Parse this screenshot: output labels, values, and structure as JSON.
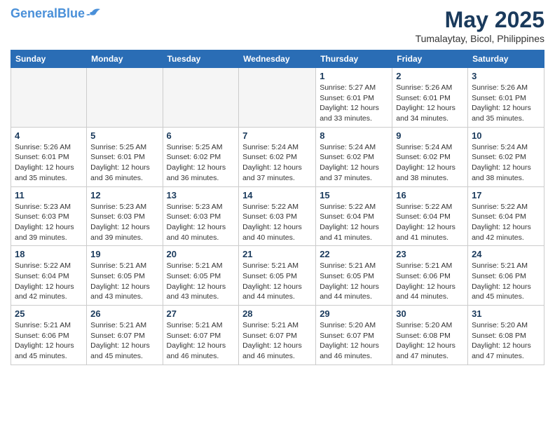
{
  "header": {
    "logo_line1": "General",
    "logo_line2": "Blue",
    "month_year": "May 2025",
    "location": "Tumalaytay, Bicol, Philippines"
  },
  "days_of_week": [
    "Sunday",
    "Monday",
    "Tuesday",
    "Wednesday",
    "Thursday",
    "Friday",
    "Saturday"
  ],
  "weeks": [
    [
      {
        "day": "",
        "info": "",
        "empty": true
      },
      {
        "day": "",
        "info": "",
        "empty": true
      },
      {
        "day": "",
        "info": "",
        "empty": true
      },
      {
        "day": "",
        "info": "",
        "empty": true
      },
      {
        "day": "1",
        "info": "Sunrise: 5:27 AM\nSunset: 6:01 PM\nDaylight: 12 hours\nand 33 minutes.",
        "empty": false
      },
      {
        "day": "2",
        "info": "Sunrise: 5:26 AM\nSunset: 6:01 PM\nDaylight: 12 hours\nand 34 minutes.",
        "empty": false
      },
      {
        "day": "3",
        "info": "Sunrise: 5:26 AM\nSunset: 6:01 PM\nDaylight: 12 hours\nand 35 minutes.",
        "empty": false
      }
    ],
    [
      {
        "day": "4",
        "info": "Sunrise: 5:26 AM\nSunset: 6:01 PM\nDaylight: 12 hours\nand 35 minutes.",
        "empty": false
      },
      {
        "day": "5",
        "info": "Sunrise: 5:25 AM\nSunset: 6:01 PM\nDaylight: 12 hours\nand 36 minutes.",
        "empty": false
      },
      {
        "day": "6",
        "info": "Sunrise: 5:25 AM\nSunset: 6:02 PM\nDaylight: 12 hours\nand 36 minutes.",
        "empty": false
      },
      {
        "day": "7",
        "info": "Sunrise: 5:24 AM\nSunset: 6:02 PM\nDaylight: 12 hours\nand 37 minutes.",
        "empty": false
      },
      {
        "day": "8",
        "info": "Sunrise: 5:24 AM\nSunset: 6:02 PM\nDaylight: 12 hours\nand 37 minutes.",
        "empty": false
      },
      {
        "day": "9",
        "info": "Sunrise: 5:24 AM\nSunset: 6:02 PM\nDaylight: 12 hours\nand 38 minutes.",
        "empty": false
      },
      {
        "day": "10",
        "info": "Sunrise: 5:24 AM\nSunset: 6:02 PM\nDaylight: 12 hours\nand 38 minutes.",
        "empty": false
      }
    ],
    [
      {
        "day": "11",
        "info": "Sunrise: 5:23 AM\nSunset: 6:03 PM\nDaylight: 12 hours\nand 39 minutes.",
        "empty": false
      },
      {
        "day": "12",
        "info": "Sunrise: 5:23 AM\nSunset: 6:03 PM\nDaylight: 12 hours\nand 39 minutes.",
        "empty": false
      },
      {
        "day": "13",
        "info": "Sunrise: 5:23 AM\nSunset: 6:03 PM\nDaylight: 12 hours\nand 40 minutes.",
        "empty": false
      },
      {
        "day": "14",
        "info": "Sunrise: 5:22 AM\nSunset: 6:03 PM\nDaylight: 12 hours\nand 40 minutes.",
        "empty": false
      },
      {
        "day": "15",
        "info": "Sunrise: 5:22 AM\nSunset: 6:04 PM\nDaylight: 12 hours\nand 41 minutes.",
        "empty": false
      },
      {
        "day": "16",
        "info": "Sunrise: 5:22 AM\nSunset: 6:04 PM\nDaylight: 12 hours\nand 41 minutes.",
        "empty": false
      },
      {
        "day": "17",
        "info": "Sunrise: 5:22 AM\nSunset: 6:04 PM\nDaylight: 12 hours\nand 42 minutes.",
        "empty": false
      }
    ],
    [
      {
        "day": "18",
        "info": "Sunrise: 5:22 AM\nSunset: 6:04 PM\nDaylight: 12 hours\nand 42 minutes.",
        "empty": false
      },
      {
        "day": "19",
        "info": "Sunrise: 5:21 AM\nSunset: 6:05 PM\nDaylight: 12 hours\nand 43 minutes.",
        "empty": false
      },
      {
        "day": "20",
        "info": "Sunrise: 5:21 AM\nSunset: 6:05 PM\nDaylight: 12 hours\nand 43 minutes.",
        "empty": false
      },
      {
        "day": "21",
        "info": "Sunrise: 5:21 AM\nSunset: 6:05 PM\nDaylight: 12 hours\nand 44 minutes.",
        "empty": false
      },
      {
        "day": "22",
        "info": "Sunrise: 5:21 AM\nSunset: 6:05 PM\nDaylight: 12 hours\nand 44 minutes.",
        "empty": false
      },
      {
        "day": "23",
        "info": "Sunrise: 5:21 AM\nSunset: 6:06 PM\nDaylight: 12 hours\nand 44 minutes.",
        "empty": false
      },
      {
        "day": "24",
        "info": "Sunrise: 5:21 AM\nSunset: 6:06 PM\nDaylight: 12 hours\nand 45 minutes.",
        "empty": false
      }
    ],
    [
      {
        "day": "25",
        "info": "Sunrise: 5:21 AM\nSunset: 6:06 PM\nDaylight: 12 hours\nand 45 minutes.",
        "empty": false
      },
      {
        "day": "26",
        "info": "Sunrise: 5:21 AM\nSunset: 6:07 PM\nDaylight: 12 hours\nand 45 minutes.",
        "empty": false
      },
      {
        "day": "27",
        "info": "Sunrise: 5:21 AM\nSunset: 6:07 PM\nDaylight: 12 hours\nand 46 minutes.",
        "empty": false
      },
      {
        "day": "28",
        "info": "Sunrise: 5:21 AM\nSunset: 6:07 PM\nDaylight: 12 hours\nand 46 minutes.",
        "empty": false
      },
      {
        "day": "29",
        "info": "Sunrise: 5:20 AM\nSunset: 6:07 PM\nDaylight: 12 hours\nand 46 minutes.",
        "empty": false
      },
      {
        "day": "30",
        "info": "Sunrise: 5:20 AM\nSunset: 6:08 PM\nDaylight: 12 hours\nand 47 minutes.",
        "empty": false
      },
      {
        "day": "31",
        "info": "Sunrise: 5:20 AM\nSunset: 6:08 PM\nDaylight: 12 hours\nand 47 minutes.",
        "empty": false
      }
    ]
  ]
}
